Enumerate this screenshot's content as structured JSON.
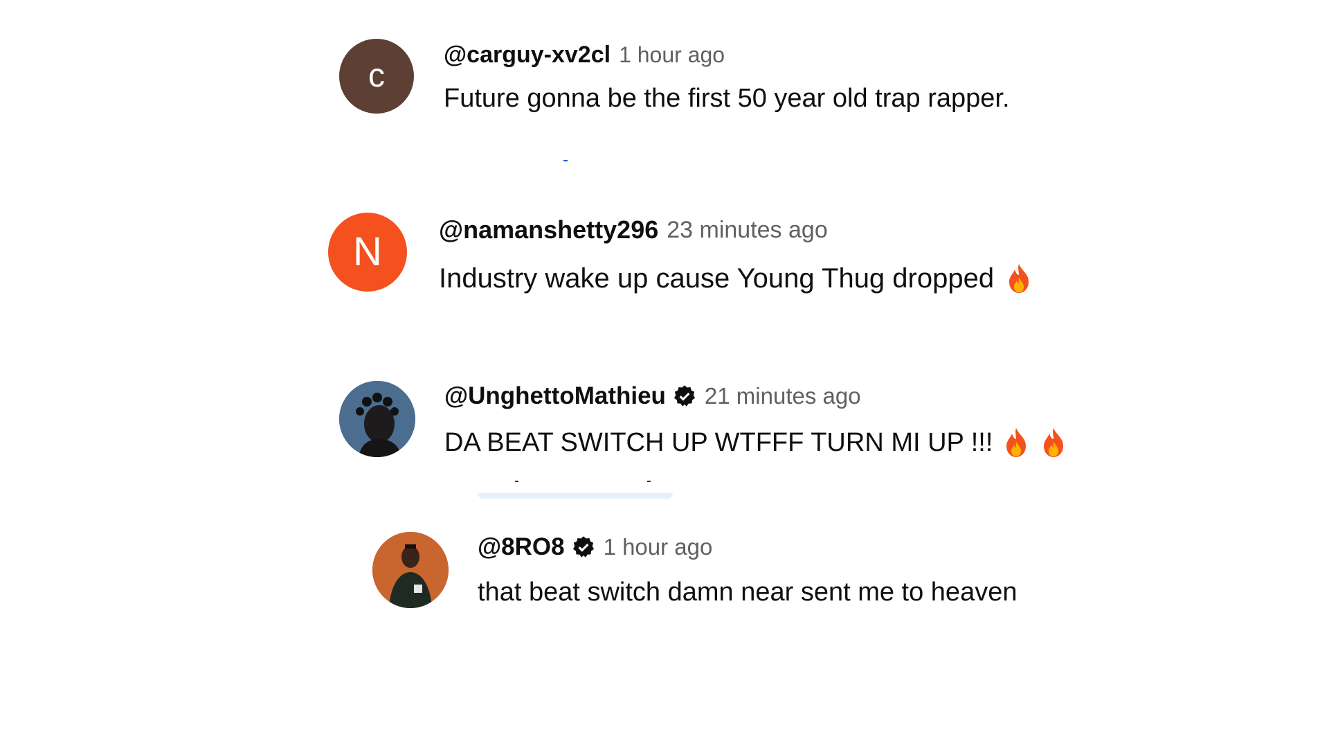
{
  "comments": [
    {
      "author": "@carguy-xv2cl",
      "time": "1 hour ago",
      "text": "Future gonna be the first 50 year old trap rapper.",
      "avatar_letter": "c",
      "avatar_color": "#5d3f34"
    },
    {
      "author": "@namanshetty296",
      "time": "23 minutes ago",
      "text": "Industry wake up cause Young Thug dropped",
      "avatar_letter": "N",
      "avatar_color": "#f4511e",
      "emoji_count": 1
    },
    {
      "author": "@UnghettoMathieu",
      "time": "21 minutes ago",
      "text": "DA BEAT SWITCH UP WTFFF TURN MI UP !!!",
      "verified": true,
      "avatar_color": "#3c5a78",
      "emoji_count": 2
    },
    {
      "author": "@8RO8",
      "time": "1 hour ago",
      "text": "that beat switch damn near sent me to heaven",
      "verified": true,
      "avatar_color": "#c9652e"
    }
  ],
  "icons": {
    "fire": "fire-emoji-icon",
    "verified": "verified-badge-icon"
  }
}
